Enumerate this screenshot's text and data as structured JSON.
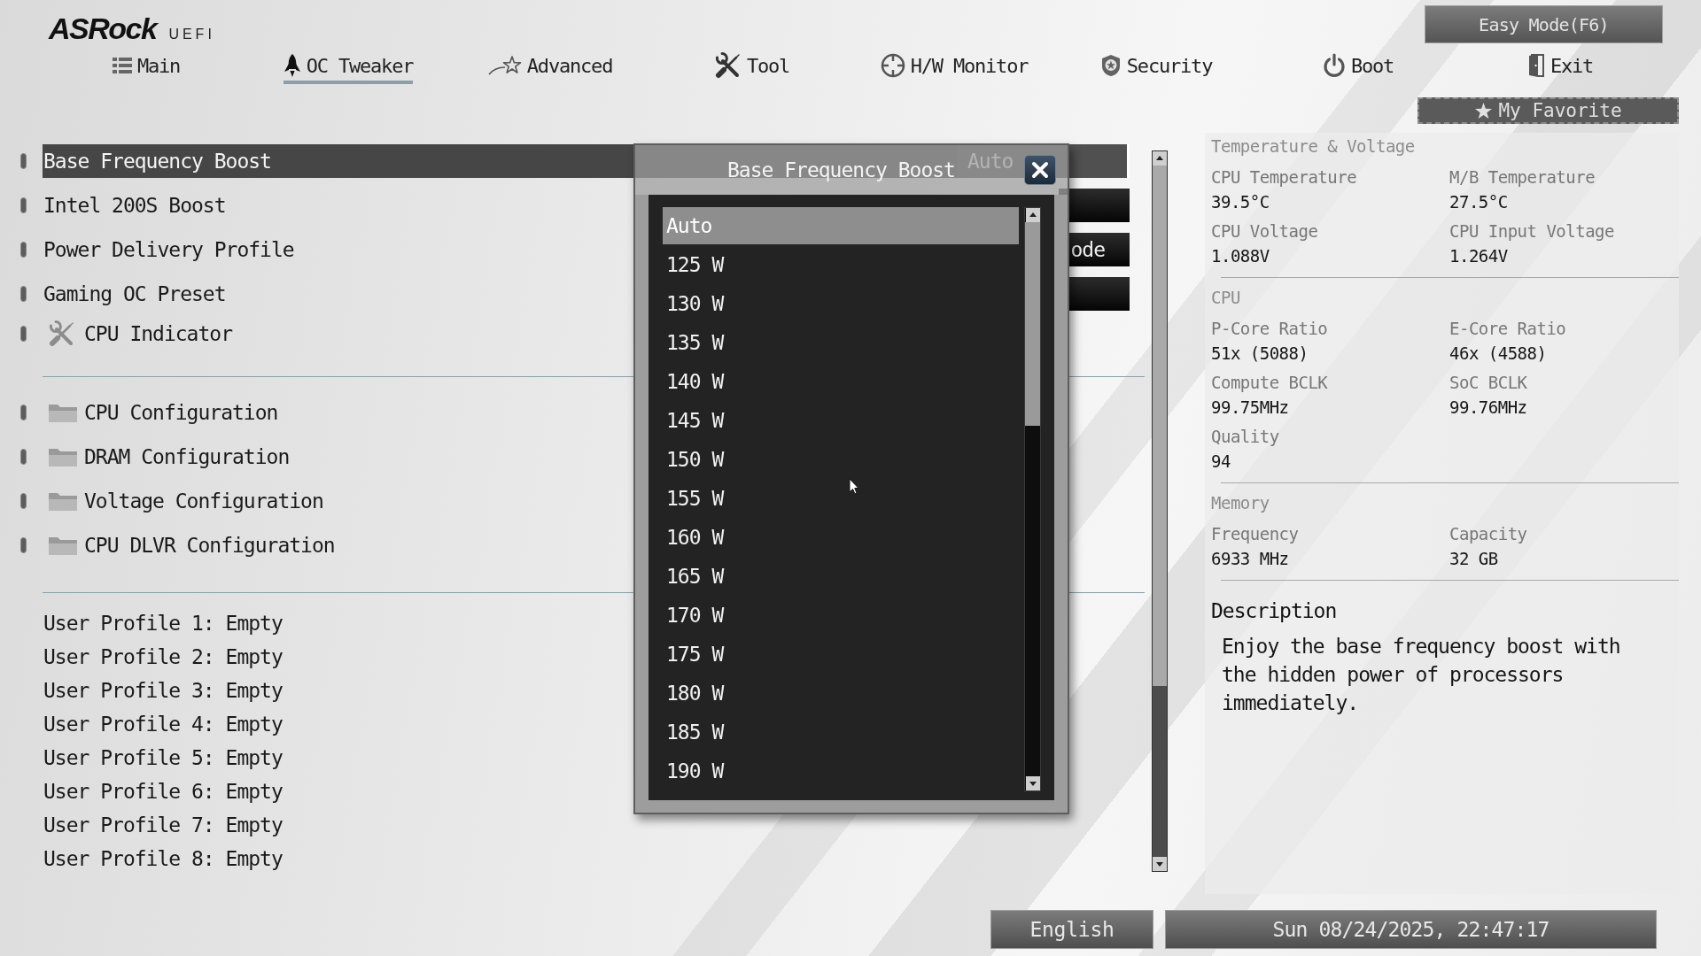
{
  "logo": {
    "brand": "ASRock",
    "product": "UEFI"
  },
  "easy_mode_button": {
    "label": "Easy Mode(F6)"
  },
  "tabs": [
    {
      "label": "Main",
      "selected": false
    },
    {
      "label": "OC Tweaker",
      "selected": true
    },
    {
      "label": "Advanced",
      "selected": false
    },
    {
      "label": "Tool",
      "selected": false
    },
    {
      "label": "H/W Monitor",
      "selected": false
    },
    {
      "label": "Security",
      "selected": false
    },
    {
      "label": "Boot",
      "selected": false
    },
    {
      "label": "Exit",
      "selected": false
    }
  ],
  "favorite_button": {
    "label": "My Favorite"
  },
  "menu_groups": [
    {
      "items": [
        {
          "kind": "option",
          "label": "Base Frequency Boost",
          "selected": true,
          "value": "Auto"
        },
        {
          "kind": "option",
          "label": "Intel 200S Boost",
          "selected": false
        },
        {
          "kind": "option",
          "label": "Power Delivery Profile",
          "selected": false,
          "value": "ode"
        },
        {
          "kind": "option",
          "label": "Gaming OC Preset",
          "selected": false
        },
        {
          "kind": "tool",
          "label": "CPU Indicator",
          "selected": false
        }
      ]
    },
    {
      "items": [
        {
          "kind": "folder",
          "label": "CPU Configuration",
          "selected": false
        },
        {
          "kind": "folder",
          "label": "DRAM Configuration",
          "selected": false
        },
        {
          "kind": "folder",
          "label": "Voltage Configuration",
          "selected": false
        },
        {
          "kind": "folder",
          "label": "CPU DLVR Configuration",
          "selected": false
        }
      ]
    },
    {
      "items": [
        {
          "kind": "profile",
          "label": "User Profile 1: Empty",
          "selected": false
        },
        {
          "kind": "profile",
          "label": "User Profile 2: Empty",
          "selected": false
        },
        {
          "kind": "profile",
          "label": "User Profile 3: Empty",
          "selected": false
        },
        {
          "kind": "profile",
          "label": "User Profile 4: Empty",
          "selected": false
        },
        {
          "kind": "profile",
          "label": "User Profile 5: Empty",
          "selected": false
        },
        {
          "kind": "profile",
          "label": "User Profile 6: Empty",
          "selected": false
        },
        {
          "kind": "profile",
          "label": "User Profile 7: Empty",
          "selected": false
        },
        {
          "kind": "profile",
          "label": "User Profile 8: Empty",
          "selected": false
        }
      ]
    }
  ],
  "popup": {
    "title": "Base Frequency Boost",
    "options": [
      {
        "label": "Auto",
        "selected": true
      },
      {
        "label": "125 W",
        "selected": false
      },
      {
        "label": "130 W",
        "selected": false
      },
      {
        "label": "135 W",
        "selected": false
      },
      {
        "label": "140 W",
        "selected": false
      },
      {
        "label": "145 W",
        "selected": false
      },
      {
        "label": "150 W",
        "selected": false
      },
      {
        "label": "155 W",
        "selected": false
      },
      {
        "label": "160 W",
        "selected": false
      },
      {
        "label": "165 W",
        "selected": false
      },
      {
        "label": "170 W",
        "selected": false
      },
      {
        "label": "175 W",
        "selected": false
      },
      {
        "label": "180 W",
        "selected": false
      },
      {
        "label": "185 W",
        "selected": false
      },
      {
        "label": "190 W",
        "selected": false
      }
    ]
  },
  "hw_monitor": {
    "sections": [
      {
        "title": "Temperature & Voltage",
        "fields": [
          {
            "label": "CPU Temperature",
            "value": "39.5°C"
          },
          {
            "label": "M/B Temperature",
            "value": "27.5°C"
          },
          {
            "label": "CPU Voltage",
            "value": "1.088V"
          },
          {
            "label": "CPU Input Voltage",
            "value": "1.264V"
          }
        ]
      },
      {
        "title": "CPU",
        "fields": [
          {
            "label": "P-Core Ratio",
            "value": "51x (5088)"
          },
          {
            "label": "E-Core Ratio",
            "value": "46x (4588)"
          },
          {
            "label": "Compute BCLK",
            "value": "99.75MHz"
          },
          {
            "label": "SoC BCLK",
            "value": "99.76MHz"
          },
          {
            "label": "Quality",
            "value": "94"
          }
        ]
      },
      {
        "title": "Memory",
        "fields": [
          {
            "label": "Frequency",
            "value": "6933 MHz"
          },
          {
            "label": "Capacity",
            "value": "32 GB"
          }
        ]
      }
    ]
  },
  "description": {
    "title": "Description",
    "text": "Enjoy the base frequency boost with the hidden power of processors immediately."
  },
  "status_bar": {
    "language": "English",
    "datetime": "Sun 08/24/2025, 22:47:17"
  }
}
